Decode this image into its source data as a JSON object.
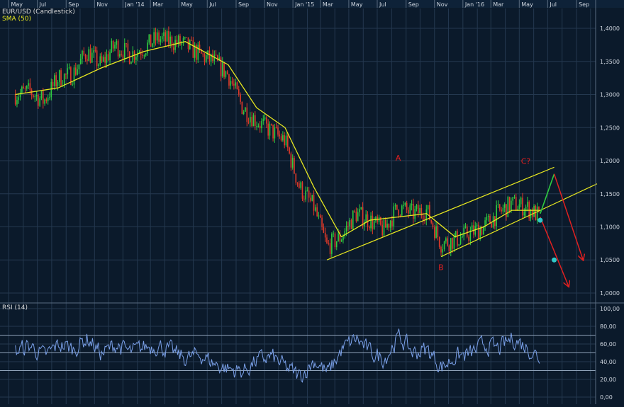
{
  "header": {
    "symbol_label": "EUR/USD (Candlestick)",
    "sma_label": "SMA (50)",
    "rsi_label": "RSI (14)"
  },
  "colors": {
    "background": "#0b1a2b",
    "grid": "#24384f",
    "sma": "#e8e820",
    "channel": "#e8e820",
    "candle_up": "#2ecc40",
    "candle_down": "#e03a2a",
    "rsi": "#7aa0e8",
    "arrow": "#e02020",
    "marker": "#30c8c8",
    "wave_label": "#e02020",
    "green_leg": "#2ecc40"
  },
  "chart_data": [
    {
      "type": "candlestick",
      "series": [
        {
          "name": "EUR/USD (Candlestick)",
          "approx_close_path": [
            {
              "x": "2013-05",
              "y": 1.3
            },
            {
              "x": "2013-06",
              "y": 1.305
            },
            {
              "x": "2013-07",
              "y": 1.29
            },
            {
              "x": "2013-08",
              "y": 1.325
            },
            {
              "x": "2013-09",
              "y": 1.33
            },
            {
              "x": "2013-10",
              "y": 1.365
            },
            {
              "x": "2013-11",
              "y": 1.345
            },
            {
              "x": "2013-12",
              "y": 1.375
            },
            {
              "x": "2014-01",
              "y": 1.36
            },
            {
              "x": "2014-02",
              "y": 1.37
            },
            {
              "x": "2014-03",
              "y": 1.385
            },
            {
              "x": "2014-04",
              "y": 1.38
            },
            {
              "x": "2014-05",
              "y": 1.375
            },
            {
              "x": "2014-06",
              "y": 1.36
            },
            {
              "x": "2014-07",
              "y": 1.35
            },
            {
              "x": "2014-08",
              "y": 1.33
            },
            {
              "x": "2014-09",
              "y": 1.28
            },
            {
              "x": "2014-10",
              "y": 1.26
            },
            {
              "x": "2014-11",
              "y": 1.245
            },
            {
              "x": "2014-12",
              "y": 1.23
            },
            {
              "x": "2015-01",
              "y": 1.16
            },
            {
              "x": "2015-02",
              "y": 1.13
            },
            {
              "x": "2015-03",
              "y": 1.07
            },
            {
              "x": "2015-04",
              "y": 1.085
            },
            {
              "x": "2015-05",
              "y": 1.12
            },
            {
              "x": "2015-06",
              "y": 1.11
            },
            {
              "x": "2015-07",
              "y": 1.095
            },
            {
              "x": "2015-08",
              "y": 1.13
            },
            {
              "x": "2015-09",
              "y": 1.12
            },
            {
              "x": "2015-10",
              "y": 1.125
            },
            {
              "x": "2015-11",
              "y": 1.075
            },
            {
              "x": "2015-12",
              "y": 1.08
            },
            {
              "x": "2016-01",
              "y": 1.09
            },
            {
              "x": "2016-02",
              "y": 1.1
            },
            {
              "x": "2016-03",
              "y": 1.12
            },
            {
              "x": "2016-04",
              "y": 1.135
            },
            {
              "x": "2016-05",
              "y": 1.13
            },
            {
              "x": "2016-06",
              "y": 1.115
            }
          ]
        },
        {
          "name": "SMA (50)",
          "values": [
            {
              "x": "2013-05",
              "y": 1.3
            },
            {
              "x": "2013-08",
              "y": 1.31
            },
            {
              "x": "2013-11",
              "y": 1.34
            },
            {
              "x": "2014-02",
              "y": 1.365
            },
            {
              "x": "2014-05",
              "y": 1.38
            },
            {
              "x": "2014-08",
              "y": 1.345
            },
            {
              "x": "2014-10",
              "y": 1.28
            },
            {
              "x": "2014-12",
              "y": 1.25
            },
            {
              "x": "2015-02",
              "y": 1.16
            },
            {
              "x": "2015-04",
              "y": 1.085
            },
            {
              "x": "2015-06",
              "y": 1.11
            },
            {
              "x": "2015-08",
              "y": 1.115
            },
            {
              "x": "2015-10",
              "y": 1.12
            },
            {
              "x": "2015-12",
              "y": 1.085
            },
            {
              "x": "2016-02",
              "y": 1.1
            },
            {
              "x": "2016-04",
              "y": 1.125
            },
            {
              "x": "2016-06",
              "y": 1.125
            }
          ]
        }
      ],
      "annotations": [
        {
          "text": "A",
          "x": "2015-08",
          "y": 1.2
        },
        {
          "text": "B",
          "x": "2015-11",
          "y": 1.035
        },
        {
          "text": "C?",
          "x": "2016-05",
          "y": 1.195
        }
      ],
      "channel_lines": [
        {
          "from": {
            "x": "2015-03",
            "y": 1.05
          },
          "to": {
            "x": "2016-07",
            "y": 1.19
          }
        },
        {
          "from": {
            "x": "2015-11",
            "y": 1.055
          },
          "to": {
            "x": "2016-10",
            "y": 1.165
          }
        }
      ],
      "projection": {
        "green_leg": [
          {
            "x": "2016-06",
            "y": 1.12
          },
          {
            "x": "2016-07",
            "y": 1.18
          }
        ],
        "red_arrows": [
          [
            {
              "x": "2016-07",
              "y": 1.18
            },
            {
              "x": "2016-09",
              "y": 1.05
            }
          ],
          [
            {
              "x": "2016-06",
              "y": 1.115
            },
            {
              "x": "2016-08",
              "y": 1.01
            }
          ]
        ],
        "markers": [
          {
            "x": "2016-06",
            "y": 1.11
          },
          {
            "x": "2016-07",
            "y": 1.05
          }
        ]
      },
      "x_tick_labels": [
        "May",
        "Jul",
        "Sep",
        "Nov",
        "Jan '14",
        "Mar",
        "May",
        "Jul",
        "Sep",
        "Nov",
        "Jan '15",
        "Mar",
        "May",
        "Jul",
        "Sep",
        "Nov",
        "Jan '16",
        "Mar",
        "May",
        "Jul",
        "Sep"
      ],
      "y_tick_labels": [
        "1,4000",
        "1,3500",
        "1,3000",
        "1,2500",
        "1,2000",
        "1,1500",
        "1,1000",
        "1,0500",
        "1,0000"
      ],
      "ylim": [
        0.985,
        1.43
      ],
      "grid": true
    },
    {
      "type": "line",
      "series": [
        {
          "name": "RSI (14)",
          "values": [
            {
              "x": "2013-05",
              "y": 52
            },
            {
              "x": "2013-06",
              "y": 60
            },
            {
              "x": "2013-07",
              "y": 45
            },
            {
              "x": "2013-08",
              "y": 62
            },
            {
              "x": "2013-09",
              "y": 55
            },
            {
              "x": "2013-10",
              "y": 70
            },
            {
              "x": "2013-11",
              "y": 48
            },
            {
              "x": "2013-12",
              "y": 62
            },
            {
              "x": "2014-01",
              "y": 50
            },
            {
              "x": "2014-02",
              "y": 58
            },
            {
              "x": "2014-03",
              "y": 60
            },
            {
              "x": "2014-04",
              "y": 52
            },
            {
              "x": "2014-05",
              "y": 42
            },
            {
              "x": "2014-06",
              "y": 48
            },
            {
              "x": "2014-07",
              "y": 35
            },
            {
              "x": "2014-08",
              "y": 28
            },
            {
              "x": "2014-09",
              "y": 25
            },
            {
              "x": "2014-10",
              "y": 40
            },
            {
              "x": "2014-11",
              "y": 45
            },
            {
              "x": "2014-12",
              "y": 30
            },
            {
              "x": "2015-01",
              "y": 18
            },
            {
              "x": "2015-02",
              "y": 40
            },
            {
              "x": "2015-03",
              "y": 22
            },
            {
              "x": "2015-04",
              "y": 55
            },
            {
              "x": "2015-05",
              "y": 70
            },
            {
              "x": "2015-06",
              "y": 50
            },
            {
              "x": "2015-07",
              "y": 42
            },
            {
              "x": "2015-08",
              "y": 72
            },
            {
              "x": "2015-09",
              "y": 50
            },
            {
              "x": "2015-10",
              "y": 55
            },
            {
              "x": "2015-11",
              "y": 30
            },
            {
              "x": "2015-12",
              "y": 45
            },
            {
              "x": "2016-01",
              "y": 48
            },
            {
              "x": "2016-02",
              "y": 62
            },
            {
              "x": "2016-03",
              "y": 55
            },
            {
              "x": "2016-04",
              "y": 70
            },
            {
              "x": "2016-05",
              "y": 58
            },
            {
              "x": "2016-06",
              "y": 42
            }
          ]
        }
      ],
      "reference_lines": [
        30,
        50,
        70
      ],
      "y_tick_labels": [
        "100,00",
        "80,00",
        "60,00",
        "40,00",
        "20,00",
        "0,00"
      ],
      "ylim": [
        0,
        100
      ],
      "grid": true
    }
  ]
}
